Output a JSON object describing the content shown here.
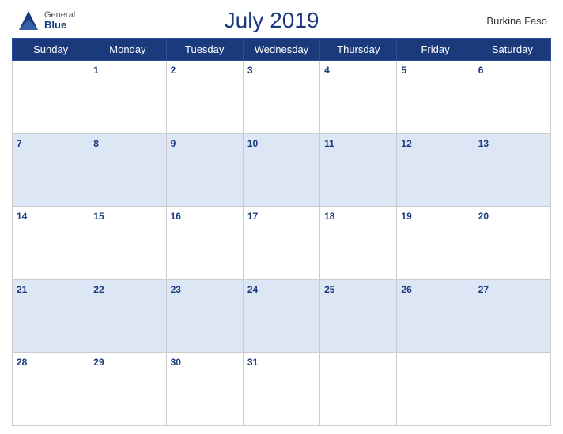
{
  "header": {
    "logo": {
      "general": "General",
      "blue": "Blue"
    },
    "title": "July 2019",
    "country": "Burkina Faso"
  },
  "calendar": {
    "days_of_week": [
      "Sunday",
      "Monday",
      "Tuesday",
      "Wednesday",
      "Thursday",
      "Friday",
      "Saturday"
    ],
    "weeks": [
      [
        null,
        1,
        2,
        3,
        4,
        5,
        6
      ],
      [
        7,
        8,
        9,
        10,
        11,
        12,
        13
      ],
      [
        14,
        15,
        16,
        17,
        18,
        19,
        20
      ],
      [
        21,
        22,
        23,
        24,
        25,
        26,
        27
      ],
      [
        28,
        29,
        30,
        31,
        null,
        null,
        null
      ]
    ]
  }
}
